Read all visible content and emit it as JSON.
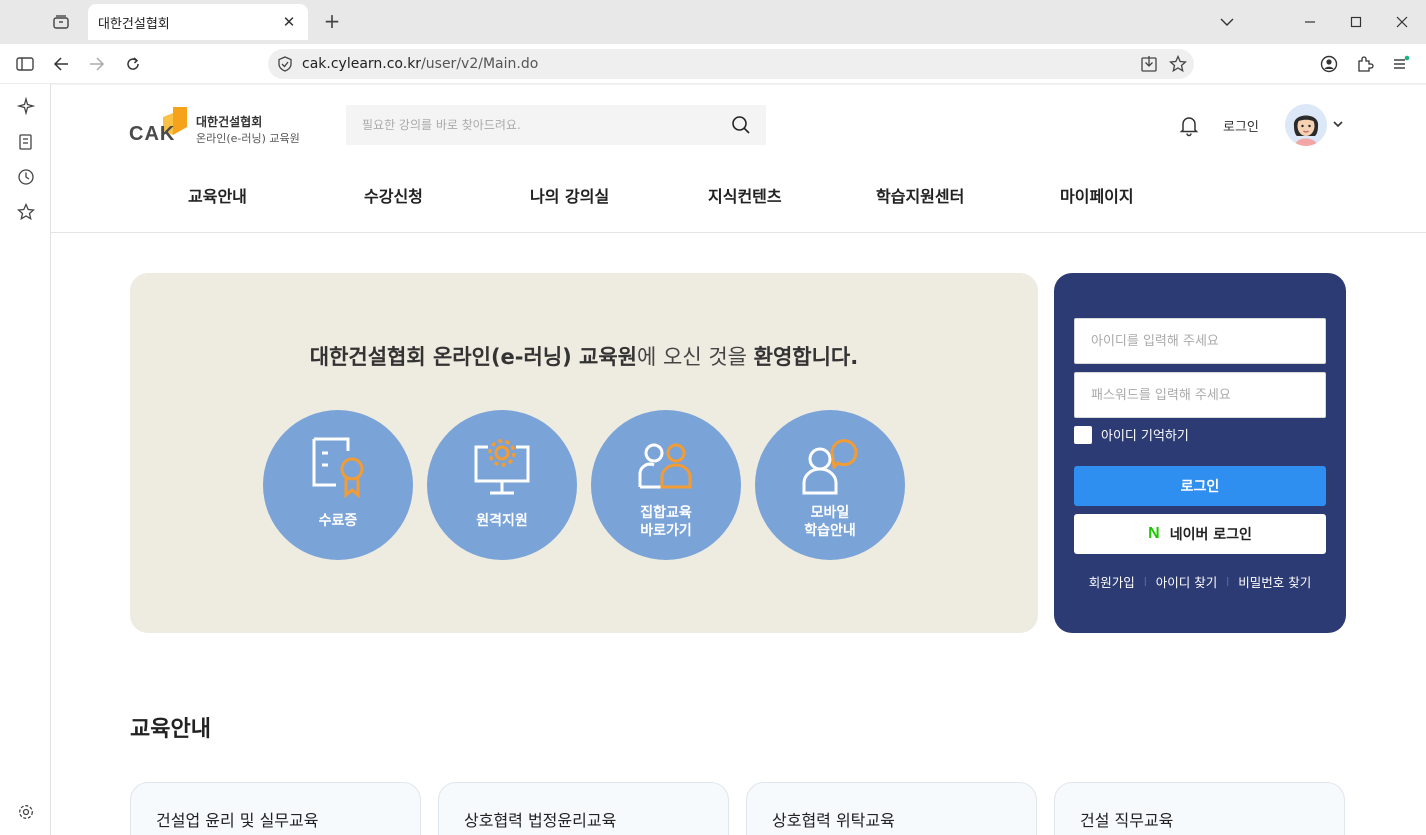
{
  "browser": {
    "tab_title": "대한건설협회",
    "url_host": "cak.cylearn.co.kr",
    "url_path": "/user/v2/Main.do"
  },
  "header": {
    "logo_text": "CAK",
    "logo_line1": "대한건설협회",
    "logo_line2": "온라인(e-러닝) 교육원",
    "search_placeholder": "필요한 강의를 바로 찾아드려요.",
    "login_link": "로그인"
  },
  "nav": {
    "items": [
      "교육안내",
      "수강신청",
      "나의 강의실",
      "지식컨텐츠",
      "학습지원센터",
      "마이페이지"
    ]
  },
  "hero": {
    "title_bold": "대한건설협회 온라인(e-러닝) 교육원",
    "title_mid": "에 오신 것을 ",
    "title_bold2": "환영합니다.",
    "shortcuts": [
      {
        "line1": "수료증",
        "line2": ""
      },
      {
        "line1": "원격지원",
        "line2": ""
      },
      {
        "line1": "집합교육",
        "line2": "바로가기"
      },
      {
        "line1": "모바일",
        "line2": "학습안내"
      }
    ]
  },
  "login": {
    "id_placeholder": "아이디를 입력해 주세요",
    "pw_placeholder": "패스워드를 입력해 주세요",
    "remember_label": "아이디 기억하기",
    "login_button": "로그인",
    "naver_button": "네이버 로그인",
    "naver_icon": "N",
    "links": [
      "회원가입",
      "아이디 찾기",
      "비밀번호 찾기"
    ]
  },
  "education": {
    "title": "교육안내",
    "cards": [
      {
        "title": "건설업 윤리 및 실무교육"
      },
      {
        "title": "상호협력 법정윤리교육"
      },
      {
        "title": "상호협력 위탁교육"
      },
      {
        "title": "건설 직무교육"
      }
    ]
  },
  "colors": {
    "hero_bg": "#eeebe0",
    "circle": "#7aa3d8",
    "accent_orange": "#f39c33",
    "login_panel": "#2c3b73",
    "login_button": "#2f8ff0",
    "naver_green": "#1ec800"
  }
}
